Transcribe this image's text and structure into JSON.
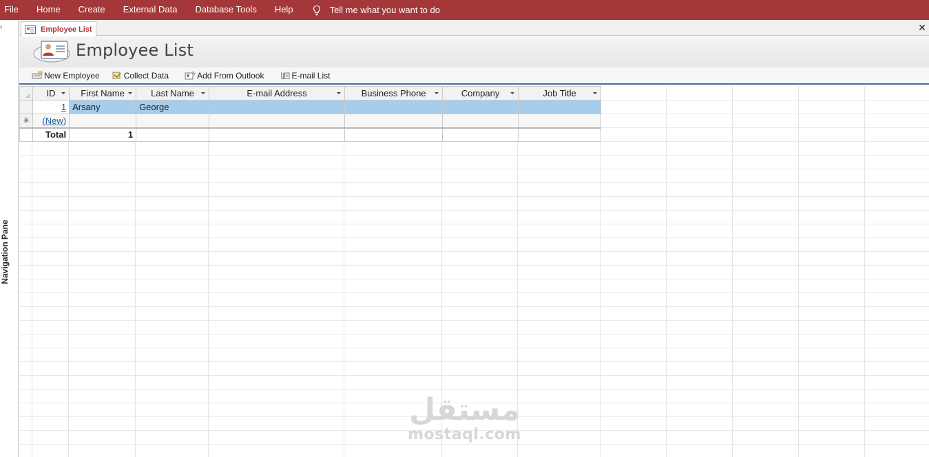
{
  "menubar": {
    "items": [
      "File",
      "Home",
      "Create",
      "External Data",
      "Database Tools",
      "Help"
    ],
    "tell_me": "Tell me what you want to do",
    "accent": "#a4373a"
  },
  "nav_pane": {
    "label": "Navigation Pane",
    "toggle_icon": "chevron-right-icon"
  },
  "doc_tab": {
    "label": "Employee List",
    "close_icon": "close-icon"
  },
  "form": {
    "title": "Employee List",
    "logo_icon": "contact-card-icon"
  },
  "toolbar": {
    "new_employee": "New Employee",
    "collect_data": "Collect Data",
    "add_from_outlook": "Add From Outlook",
    "email_list": "E-mail List"
  },
  "grid": {
    "columns": [
      "ID",
      "First Name",
      "Last Name",
      "E-mail Address",
      "Business Phone",
      "Company",
      "Job Title"
    ],
    "rows": [
      {
        "id": "1",
        "first_name": "Arsany",
        "last_name": "George",
        "email": "",
        "phone": "",
        "company": "",
        "job_title": ""
      }
    ],
    "new_row_label": "(New)",
    "new_row_marker": "✳",
    "total_label": "Total",
    "total_value": "1",
    "selection_color": "#a6cdec"
  },
  "watermark": {
    "arabic": "مستقل",
    "latin": "mostaql.com"
  }
}
